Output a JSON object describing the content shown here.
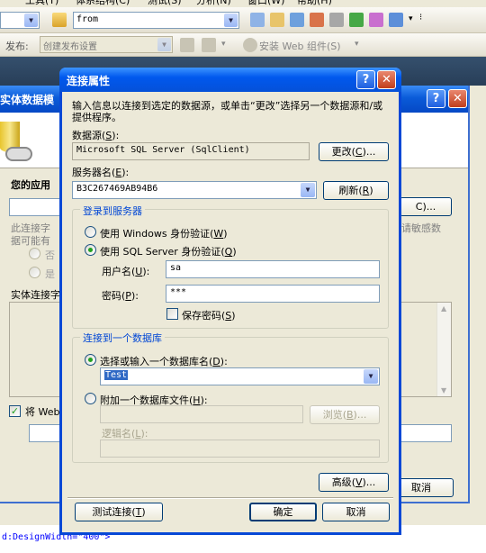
{
  "menu": {
    "items": [
      "工具(T)",
      "体系结构(C)",
      "测试(S)",
      "分析(N)",
      "窗口(W)",
      "帮助(H)"
    ]
  },
  "toolbar1": {
    "search_value": "from"
  },
  "toolbar2": {
    "publish_label": "发布:",
    "publish_value": "创建发布设置",
    "install_label": "安装 Web 组件(S)"
  },
  "bg_wizard": {
    "title": "实体数据模",
    "app_label": "您的应用",
    "hint_line1": "此连接字",
    "hint_line2": "据可能有",
    "hint_right": "请敏感数",
    "radio_no": "否",
    "radio_yes": "是",
    "conn_str_label": "实体连接字",
    "save_label": "将 Web",
    "button_c": "C)...",
    "cancel": "取消",
    "xaml_snippet": "d:DesignWidth=\"400\">"
  },
  "dialog": {
    "title": "连接属性",
    "intro": "输入信息以连接到选定的数据源，或单击“更改”选择另一个数据源和/或提供程序。",
    "datasource_label": "数据源",
    "datasource_key": "S",
    "datasource_value": "Microsoft SQL Server (SqlClient)",
    "change_button": "更改",
    "change_key": "C",
    "server_label": "服务器名",
    "server_key": "E",
    "server_value": "B3C267469AB94B6",
    "refresh_button": "刷新",
    "refresh_key": "R",
    "login_group": "登录到服务器",
    "windows_auth": "使用 Windows 身份验证",
    "windows_auth_key": "W",
    "sql_auth": "使用 SQL Server 身份验证",
    "sql_auth_key": "Q",
    "username_label": "用户名",
    "username_key": "U",
    "username_value": "sa",
    "password_label": "密码",
    "password_key": "P",
    "password_value": "***",
    "save_password": "保存密码",
    "save_password_key": "S",
    "db_group": "连接到一个数据库",
    "select_db": "选择或输入一个数据库名",
    "select_db_key": "D",
    "db_value": "Test",
    "attach_db": "附加一个数据库文件",
    "attach_db_key": "H",
    "browse_button": "浏览",
    "browse_key": "B",
    "logical_name": "逻辑名",
    "logical_key": "L",
    "advanced_button": "高级",
    "advanced_key": "V",
    "test_button": "测试连接",
    "test_key": "T",
    "ok_button": "确定",
    "cancel_button": "取消"
  },
  "colors": {
    "title_blue": "#0054e3",
    "group_label": "#0046d5",
    "xp_face": "#ece9d8"
  }
}
